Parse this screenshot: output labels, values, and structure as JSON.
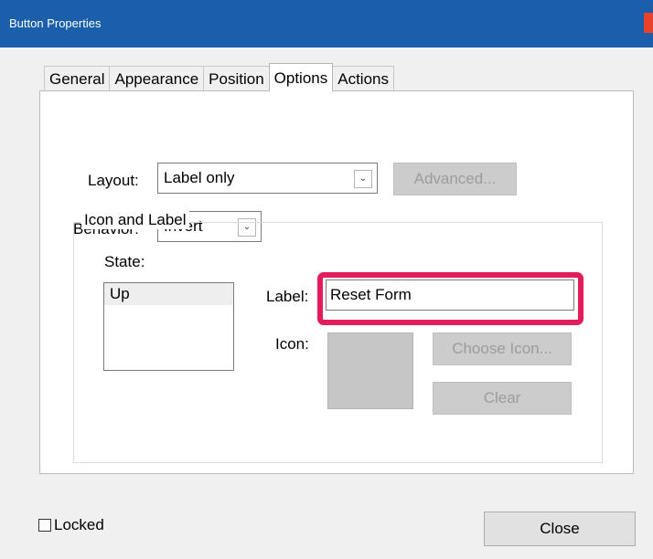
{
  "window": {
    "title": "Button Properties"
  },
  "tabs": [
    {
      "label": "General",
      "active": false
    },
    {
      "label": "Appearance",
      "active": false
    },
    {
      "label": "Position",
      "active": false
    },
    {
      "label": "Options",
      "active": true
    },
    {
      "label": "Actions",
      "active": false
    }
  ],
  "options": {
    "layout": {
      "label": "Layout:",
      "value": "Label only"
    },
    "advanced_button": "Advanced...",
    "behavior": {
      "label": "Behavior:",
      "value": "Invert"
    },
    "icon_and_label": {
      "group_title": "Icon and Label",
      "state_label": "State:",
      "states": [
        "Up"
      ],
      "label_field": {
        "label": "Label:",
        "value": "Reset Form"
      },
      "icon_label": "Icon:",
      "choose_icon_button": "Choose Icon...",
      "clear_button": "Clear"
    }
  },
  "footer": {
    "locked_label": "Locked",
    "locked_checked": false,
    "close_button": "Close"
  },
  "colors": {
    "titlebar": "#1b5faa",
    "highlight": "#e41c5c",
    "disabled_button": "#cccccc"
  }
}
